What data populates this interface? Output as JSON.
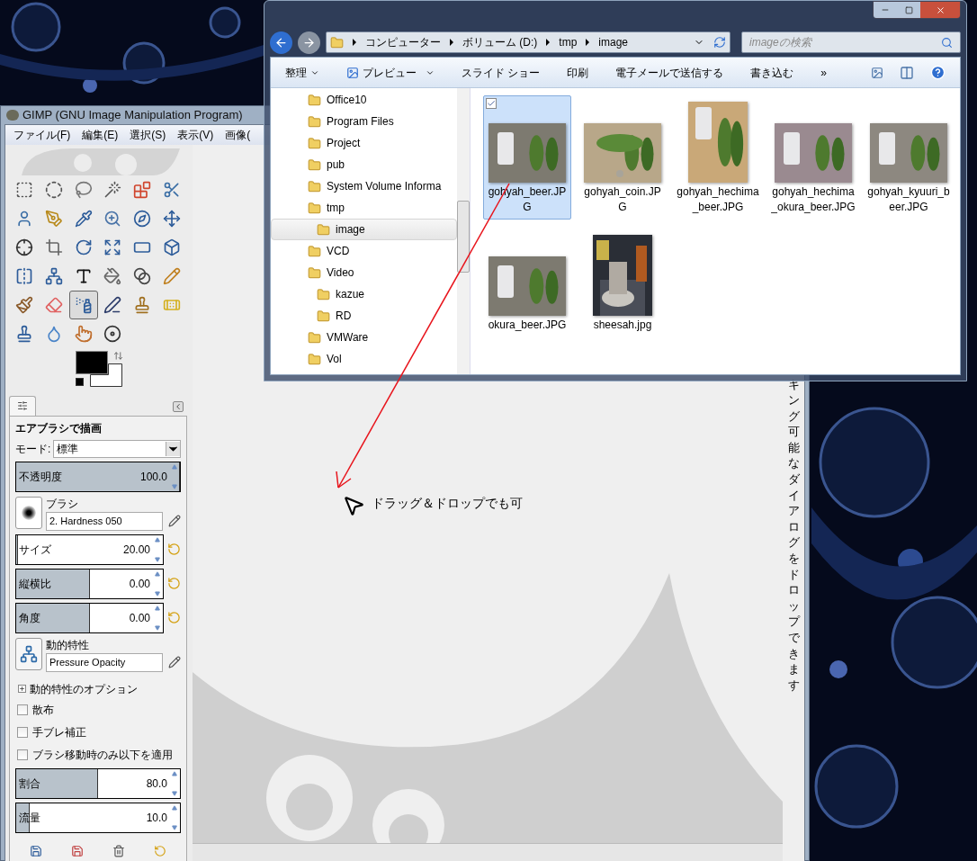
{
  "gimp": {
    "title": "GIMP (GNU Image Manipulation Program)",
    "menu": [
      "ファイル(F)",
      "編集(E)",
      "選択(S)",
      "表示(V)",
      "画像("
    ],
    "tools": [
      {
        "selected": false
      },
      {
        "selected": false
      },
      {
        "selected": false
      },
      {
        "selected": false
      },
      {
        "selected": false
      },
      {
        "selected": false
      },
      {
        "selected": false
      },
      {
        "selected": false
      },
      {
        "selected": false
      },
      {
        "selected": false
      },
      {
        "selected": false
      },
      {
        "selected": false
      },
      {
        "selected": false
      },
      {
        "selected": false
      },
      {
        "selected": false
      },
      {
        "selected": false
      },
      {
        "selected": false
      },
      {
        "selected": false
      },
      {
        "selected": false
      },
      {
        "selected": false
      },
      {
        "selected": false
      },
      {
        "selected": false
      },
      {
        "selected": false
      },
      {
        "selected": false
      },
      {
        "selected": false
      },
      {
        "selected": false
      },
      {
        "selected": true
      },
      {
        "selected": false
      },
      {
        "selected": false
      },
      {
        "selected": false
      },
      {
        "selected": false
      },
      {
        "selected": false
      },
      {
        "selected": false
      },
      {
        "selected": false
      }
    ],
    "tool_options": {
      "title": "エアブラシで描画",
      "mode": {
        "label": "モード:",
        "value": "標準"
      },
      "opacity": {
        "label": "不透明度",
        "value": "100.0",
        "level": 1
      },
      "brush": {
        "label": "ブラシ",
        "value": "2. Hardness 050"
      },
      "shape_sliders": [
        {
          "label": "サイズ",
          "value": "20.00",
          "level": 0.01
        },
        {
          "label": "縦横比",
          "value": "0.00",
          "level": 0.5
        },
        {
          "label": "角度",
          "value": "0.00",
          "level": 0.5
        }
      ],
      "dynamics": {
        "label": "動的特性",
        "value": "Pressure Opacity"
      },
      "dynamics_options": {
        "label": "動的特性のオプション",
        "expanded": false
      },
      "checkboxes": [
        {
          "label": "散布",
          "checked": false
        },
        {
          "label": "手ブレ補正",
          "checked": false
        },
        {
          "label": "ブラシ移動時のみ以下を適用",
          "checked": false
        }
      ],
      "rate_sliders": [
        {
          "label": "割合",
          "value": "80.0",
          "level": 0.5
        },
        {
          "label": "流量",
          "value": "10.0",
          "level": 0.08
        }
      ]
    },
    "canvas": {
      "hint": "ドラッグ＆ドロップでも可",
      "vertical_text": "キング可能なダイアログをドロップできます"
    }
  },
  "explorer": {
    "breadcrumbs": [
      "コンピューター",
      "ボリューム (D:)",
      "tmp",
      "image"
    ],
    "search": {
      "placeholder": "imageの検索"
    },
    "toolbar": [
      {
        "label": "整理",
        "kind": "menu"
      },
      {
        "label": "プレビュー",
        "kind": "preview"
      },
      {
        "label": "スライド ショー",
        "kind": "plain"
      },
      {
        "label": "印刷",
        "kind": "plain"
      },
      {
        "label": "電子メールで送信する",
        "kind": "plain"
      },
      {
        "label": "書き込む",
        "kind": "plain"
      },
      {
        "label": "»",
        "kind": "plain"
      }
    ],
    "tree": [
      {
        "label": "Office10",
        "selected": false
      },
      {
        "label": "Program Files",
        "selected": false
      },
      {
        "label": "Project",
        "selected": false
      },
      {
        "label": "pub",
        "selected": false
      },
      {
        "label": "System Volume Informa",
        "selected": false
      },
      {
        "label": "tmp",
        "selected": false,
        "children": [
          {
            "label": "image",
            "selected": true
          }
        ]
      },
      {
        "label": "VCD",
        "selected": false
      },
      {
        "label": "Video",
        "selected": false,
        "children": [
          {
            "label": "kazue",
            "selected": false
          },
          {
            "label": "RD",
            "selected": false
          }
        ]
      },
      {
        "label": "VMWare",
        "selected": false
      },
      {
        "label": "Vol",
        "selected": false
      }
    ],
    "files": [
      {
        "name": "gohyah_beer.JPG",
        "selected": true,
        "checked": true
      },
      {
        "name": "gohyah_coin.JPG",
        "selected": false,
        "checked": false
      },
      {
        "name": "gohyah_hechima_beer.JPG",
        "selected": false,
        "checked": false
      },
      {
        "name": "gohyah_hechima_okura_beer.JPG",
        "selected": false,
        "checked": false
      },
      {
        "name": "gohyah_kyuuri_beer.JPG",
        "selected": false,
        "checked": false
      },
      {
        "name": "okura_beer.JPG",
        "selected": false,
        "checked": false
      },
      {
        "name": "sheesah.jpg",
        "selected": false,
        "checked": false
      }
    ]
  }
}
